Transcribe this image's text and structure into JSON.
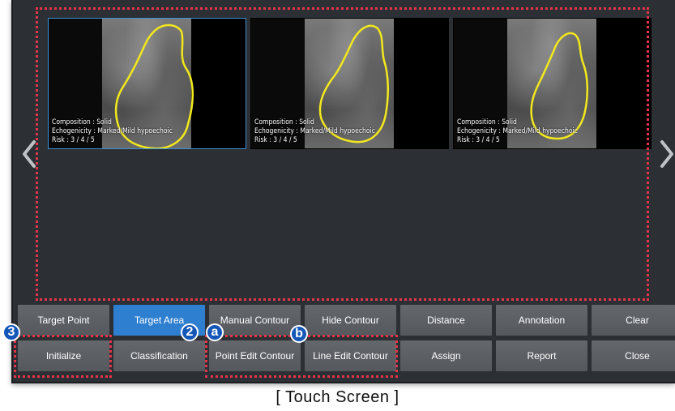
{
  "thumbnails": [
    {
      "line1": "Composition : Solid",
      "line2": "Echogenicity : Marked/Mild hypoechoic",
      "line3": "Risk : 3 / 4 / 5",
      "selected": true
    },
    {
      "line1": "Composition : Solid",
      "line2": "Echogenicity : Marked/Mild hypoechoic",
      "line3": "Risk : 3 / 4 / 5",
      "selected": false
    },
    {
      "line1": "Composition : Solid",
      "line2": "Echogenicity : Marked/Mild hypoechoic",
      "line3": "Risk : 3 / 4 / 5",
      "selected": false
    }
  ],
  "buttons": {
    "row1": [
      "Target Point",
      "Target Area",
      "Manual Contour",
      "Hide Contour",
      "Distance",
      "Annotation",
      "Clear"
    ],
    "row2": [
      "Initialize",
      "Classification",
      "Point Edit Contour",
      "Line Edit Contour",
      "Assign",
      "Report",
      "Close"
    ],
    "active": "Target Area"
  },
  "badges": {
    "b3": "3",
    "b2": "2",
    "ba": "a",
    "bb": "b"
  },
  "colors": {
    "contour": "#f2e81c",
    "active": "#2f7fd0",
    "highlight": "#e8344a",
    "badge": "#1457b8"
  },
  "caption": "[ Touch Screen ]"
}
